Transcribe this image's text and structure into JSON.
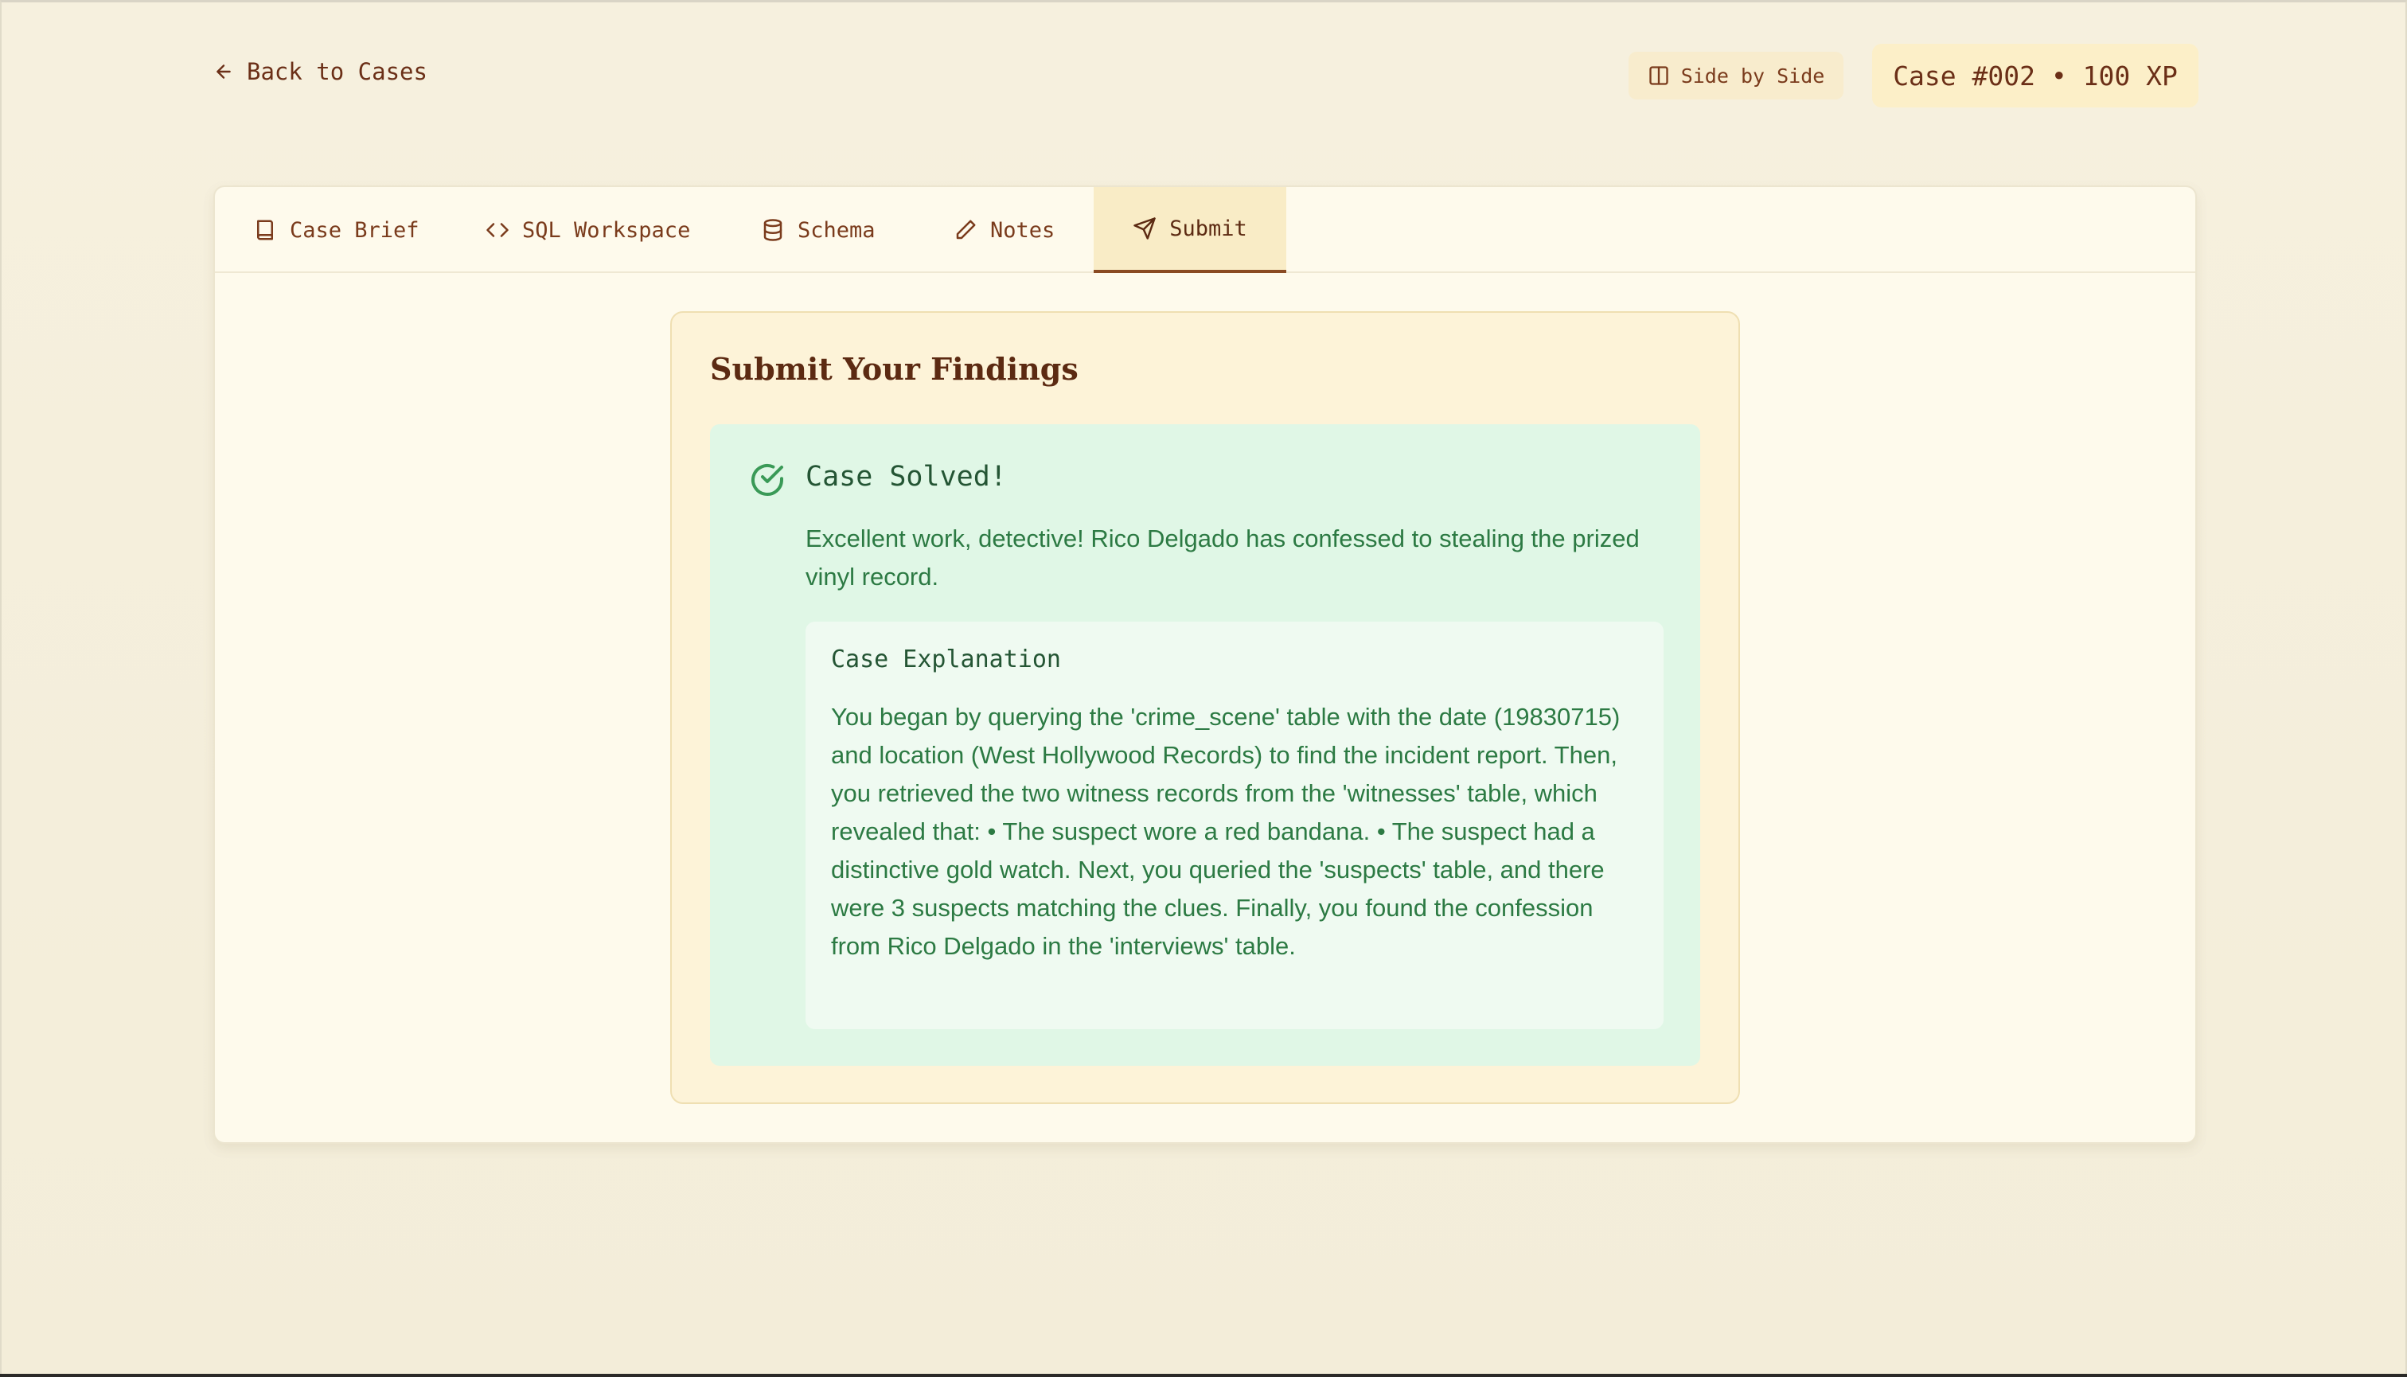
{
  "header": {
    "back_label": "Back to Cases",
    "view_toggle_label": "Side by Side",
    "case_badge": "Case #002 • 100 XP"
  },
  "tabs": [
    {
      "label": "Case Brief",
      "icon": "book-icon"
    },
    {
      "label": "SQL Workspace",
      "icon": "code-icon"
    },
    {
      "label": "Schema",
      "icon": "database-icon"
    },
    {
      "label": "Notes",
      "icon": "pencil-icon"
    },
    {
      "label": "Submit",
      "icon": "send-icon",
      "active": true
    }
  ],
  "submit": {
    "title": "Submit Your Findings",
    "result": {
      "title": "Case Solved!",
      "message": "Excellent work, detective! Rico Delgado has confessed to stealing the prized vinyl record.",
      "explanation_title": "Case Explanation",
      "explanation_text": "You began by querying the 'crime_scene' table with the date (19830715) and location (West Hollywood Records) to find the incident report. Then, you retrieved the two witness records from the 'witnesses' table, which revealed that: • The suspect wore a red bandana. • The suspect had a distinctive gold watch. Next, you queried the 'suspects' table, and there were 3 suspects matching the clues. Finally, you found the confession from Rico Delgado in the 'interviews' table."
    }
  },
  "colors": {
    "background": "#f5efdc",
    "accent_brown": "#7a3b1c",
    "success_bg": "#e0f7e6",
    "success_text": "#2c7a43"
  }
}
